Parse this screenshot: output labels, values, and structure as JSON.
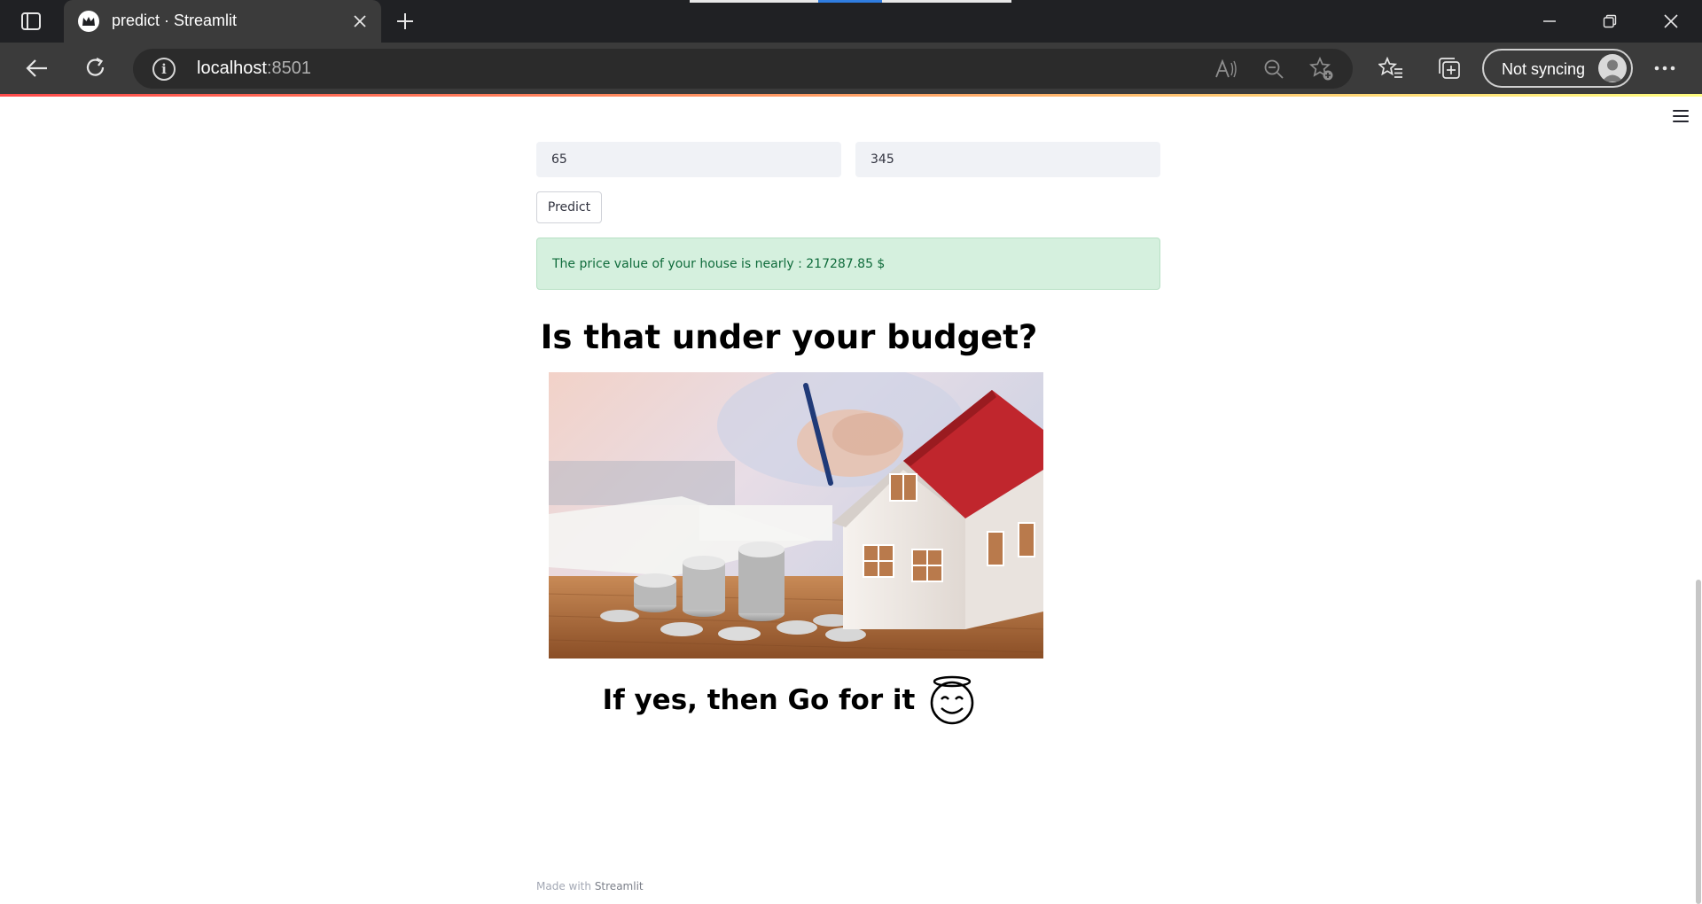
{
  "browser": {
    "tab_title": "predict · Streamlit",
    "url_host": "localhost",
    "url_port": ":8501",
    "profile_label": "Not syncing"
  },
  "form": {
    "input_left_value": "65",
    "input_right_value": "345",
    "predict_label": "Predict"
  },
  "result": {
    "message": "The price value of your house is nearly : 217287.85 $"
  },
  "content": {
    "budget_question": "Is that under your budget?",
    "go_for_it": "If yes, then Go for it",
    "emoji_icon": "smiling-face-with-halo-icon"
  },
  "footer": {
    "made_with": "Made with",
    "brand": "Streamlit"
  },
  "colors": {
    "chrome_dark": "#202124",
    "success_bg": "#d5f0de",
    "success_text": "#0f6b3b",
    "house_roof": "#c0262d"
  }
}
